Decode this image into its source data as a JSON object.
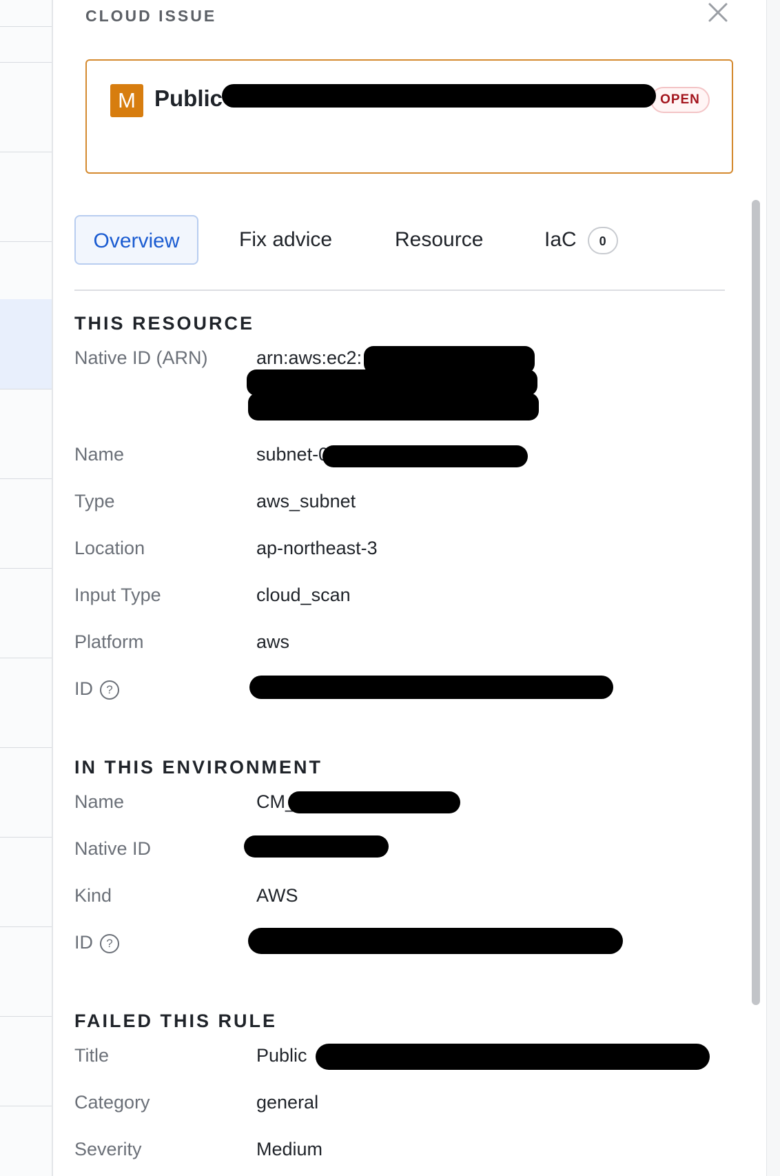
{
  "header": {
    "kicker": "CLOUD ISSUE",
    "close_icon": "close-icon"
  },
  "issue": {
    "severity_letter": "M",
    "title": "Public",
    "status": "OPEN",
    "severity_color": "#d77d0f"
  },
  "tabs": [
    {
      "label": "Overview",
      "active": true
    },
    {
      "label": "Fix advice"
    },
    {
      "label": "Resource"
    },
    {
      "label": "IaC",
      "count": "0"
    }
  ],
  "this_resource": {
    "title": "THIS RESOURCE",
    "fields": {
      "arn": {
        "label": "Native ID (ARN)",
        "value": "arn:aws:ec2:"
      },
      "name": {
        "label": "Name",
        "value": "subnet-0"
      },
      "type": {
        "label": "Type",
        "value": "aws_subnet"
      },
      "location": {
        "label": "Location",
        "value": "ap-northeast-3"
      },
      "input_type": {
        "label": "Input Type",
        "value": "cloud_scan"
      },
      "platform": {
        "label": "Platform",
        "value": "aws"
      },
      "id": {
        "label": "ID",
        "value": ""
      }
    }
  },
  "environment": {
    "title": "IN THIS ENVIRONMENT",
    "fields": {
      "name": {
        "label": "Name",
        "value": "CM_"
      },
      "native_id": {
        "label": "Native ID",
        "value": ""
      },
      "kind": {
        "label": "Kind",
        "value": "AWS"
      },
      "id": {
        "label": "ID",
        "value": ""
      }
    }
  },
  "rule": {
    "title": "FAILED THIS RULE",
    "fields": {
      "title": {
        "label": "Title",
        "value": "Public"
      },
      "category": {
        "label": "Category",
        "value": "general"
      },
      "severity": {
        "label": "Severity",
        "value": "Medium"
      }
    }
  },
  "help_glyph": "?"
}
